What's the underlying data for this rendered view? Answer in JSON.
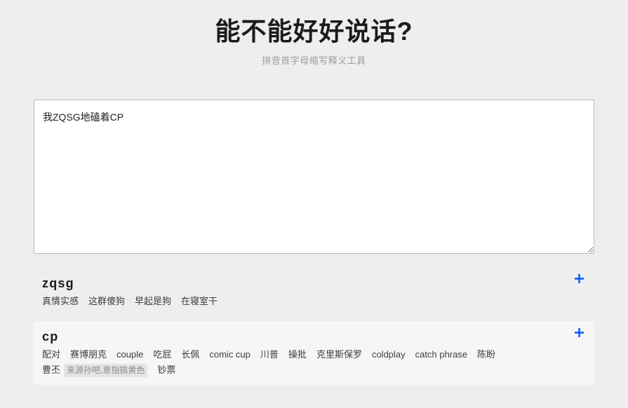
{
  "header": {
    "title": "能不能好好说话?",
    "subtitle": "拼音首字母缩写释义工具"
  },
  "input": {
    "value": "我ZQSG地磕着CP",
    "placeholder": ""
  },
  "colors": {
    "page_background": "#eeeeee",
    "card_background": "#f6f6f6",
    "accent": "#0b5fff",
    "title": "#1b1b1b",
    "subtitle": "#9a9a9a",
    "meaning_text": "#3d3d3d",
    "note_background": "#e4e4e4",
    "note_text": "#8d8d8d"
  },
  "results": [
    {
      "term": "zqsg",
      "hovered": false,
      "add_label": "+",
      "add_icon": "plus-icon",
      "meanings": [
        {
          "text": "真情实感",
          "note": ""
        },
        {
          "text": "这群傻狗",
          "note": ""
        },
        {
          "text": "早起是狗",
          "note": ""
        },
        {
          "text": "在寝室干",
          "note": ""
        }
      ]
    },
    {
      "term": "cp",
      "hovered": true,
      "add_label": "+",
      "add_icon": "plus-icon",
      "meanings": [
        {
          "text": "配对",
          "note": ""
        },
        {
          "text": "赛博朋克",
          "note": ""
        },
        {
          "text": "couple",
          "note": ""
        },
        {
          "text": "吃屁",
          "note": ""
        },
        {
          "text": "长佩",
          "note": ""
        },
        {
          "text": "comic cup",
          "note": ""
        },
        {
          "text": "川普",
          "note": ""
        },
        {
          "text": "操批",
          "note": ""
        },
        {
          "text": "克里斯保罗",
          "note": ""
        },
        {
          "text": "coldplay",
          "note": ""
        },
        {
          "text": "catch phrase",
          "note": ""
        },
        {
          "text": "陈盼",
          "note": ""
        },
        {
          "text": "曹丕",
          "note": "来源孙吧,意指搞黄色"
        },
        {
          "text": "钞票",
          "note": ""
        }
      ]
    }
  ]
}
